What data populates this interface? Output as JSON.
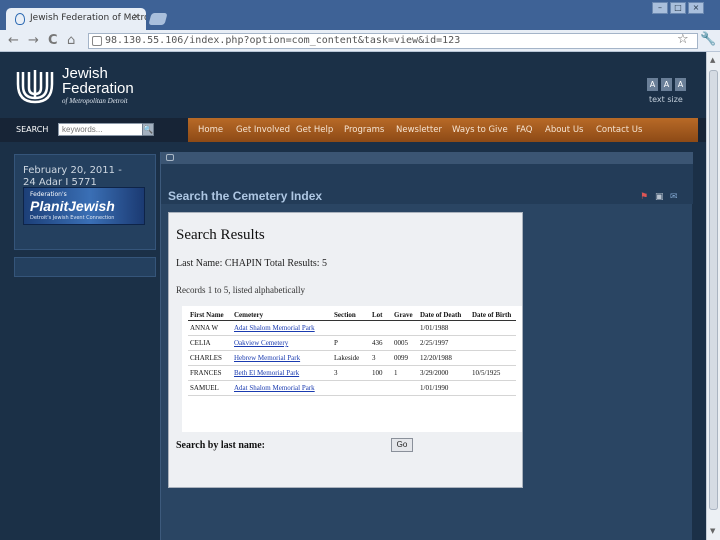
{
  "browser": {
    "tab_title": "Jewish Federation of Metro...",
    "tab_close": "×",
    "url": "98.130.55.106/index.php?option=com_content&task=view&id=123",
    "window_minimize": "–",
    "window_restore": "□",
    "window_close": "×",
    "back": "←",
    "forward": "→",
    "reload": "C",
    "home": "⌂",
    "star": "☆",
    "wrench": "🔧"
  },
  "site": {
    "logo_line1": "Jewish",
    "logo_line2": "Federation",
    "logo_line3": "of Metropolitan Detroit",
    "text_size_buttons": [
      "A",
      "A",
      "A"
    ],
    "text_size_label": "text size"
  },
  "navbar": {
    "search_label": "SEARCH",
    "search_placeholder": "keywords...",
    "search_go": "🔍",
    "menu": [
      "Home",
      "Get Involved",
      "Get Help",
      "Programs",
      "Newsletter",
      "Ways to Give",
      "FAQ",
      "About Us",
      "Contact Us"
    ]
  },
  "sidebar": {
    "date_gregorian": "February 20, 2011 -",
    "date_hebrew": "24 Adar I 5771",
    "banner_top": "Federation's",
    "banner_main": "PlanitJewish",
    "banner_sub": "Detroit's Jewish Event Connection"
  },
  "content": {
    "page_title": "Search the Cemetery Index",
    "results_title": "Search Results",
    "summary": "Last Name: CHAPIN Total Results: 5",
    "records_note": "Records 1 to 5, listed alphabetically",
    "table": {
      "headers": [
        "First Name",
        "Cemetery",
        "Section",
        "Lot",
        "Grave",
        "Date of Death",
        "Date of Birth"
      ],
      "rows": [
        [
          "ANNA  W",
          "Adat Shalom Memorial Park",
          "",
          "",
          "",
          "1/01/1988",
          ""
        ],
        [
          "CELIA",
          "Oakview Cemetery",
          "P",
          "436",
          "0005",
          "2/25/1997",
          ""
        ],
        [
          "CHARLES",
          "Hebrew Memorial Park",
          "Lakeside",
          "3",
          "0099",
          "12/20/1988",
          ""
        ],
        [
          "FRANCES",
          "Beth El Memorial Park",
          "3",
          "100",
          "1",
          "3/29/2000",
          "10/5/1925"
        ],
        [
          "SAMUEL",
          "Adat Shalom Memorial Park",
          "",
          "",
          "",
          "1/01/1990",
          ""
        ]
      ]
    },
    "search_by_last": "Search by last name:",
    "go_label": "Go"
  },
  "colors": {
    "page_bg": "#1b3047",
    "menu_orange": "#b86a27",
    "link": "#1a3bb0"
  }
}
